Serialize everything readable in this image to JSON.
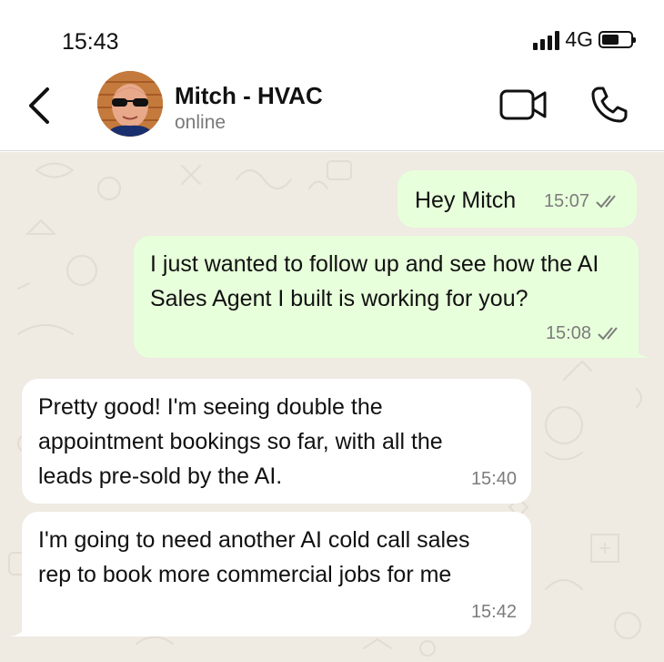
{
  "status_bar": {
    "time": "15:43",
    "network": "4G",
    "signal_icon": "signal-bars-icon",
    "battery_icon": "battery-icon"
  },
  "header": {
    "back_icon": "chevron-left-icon",
    "contact_name": "Mitch - HVAC",
    "contact_status": "online",
    "video_icon": "video-camera-icon",
    "call_icon": "phone-icon"
  },
  "messages": [
    {
      "direction": "out",
      "text": "Hey Mitch",
      "time": "15:07",
      "status": "read"
    },
    {
      "direction": "out",
      "text": "I just wanted to follow up and see how the AI Sales Agent I built is working for you?",
      "time": "15:08",
      "status": "read"
    },
    {
      "direction": "in",
      "text": "Pretty good! I'm seeing double the appointment bookings so far, with all the leads pre-sold by the AI.",
      "time": "15:40"
    },
    {
      "direction": "in",
      "text": "I'm going to need another AI cold call sales rep to book more commercial jobs for me",
      "time": "15:42"
    }
  ],
  "colors": {
    "outgoing_bubble": "#e7ffdb",
    "incoming_bubble": "#ffffff",
    "chat_background": "#efeae2",
    "tick_color": "#7c7c7c"
  }
}
